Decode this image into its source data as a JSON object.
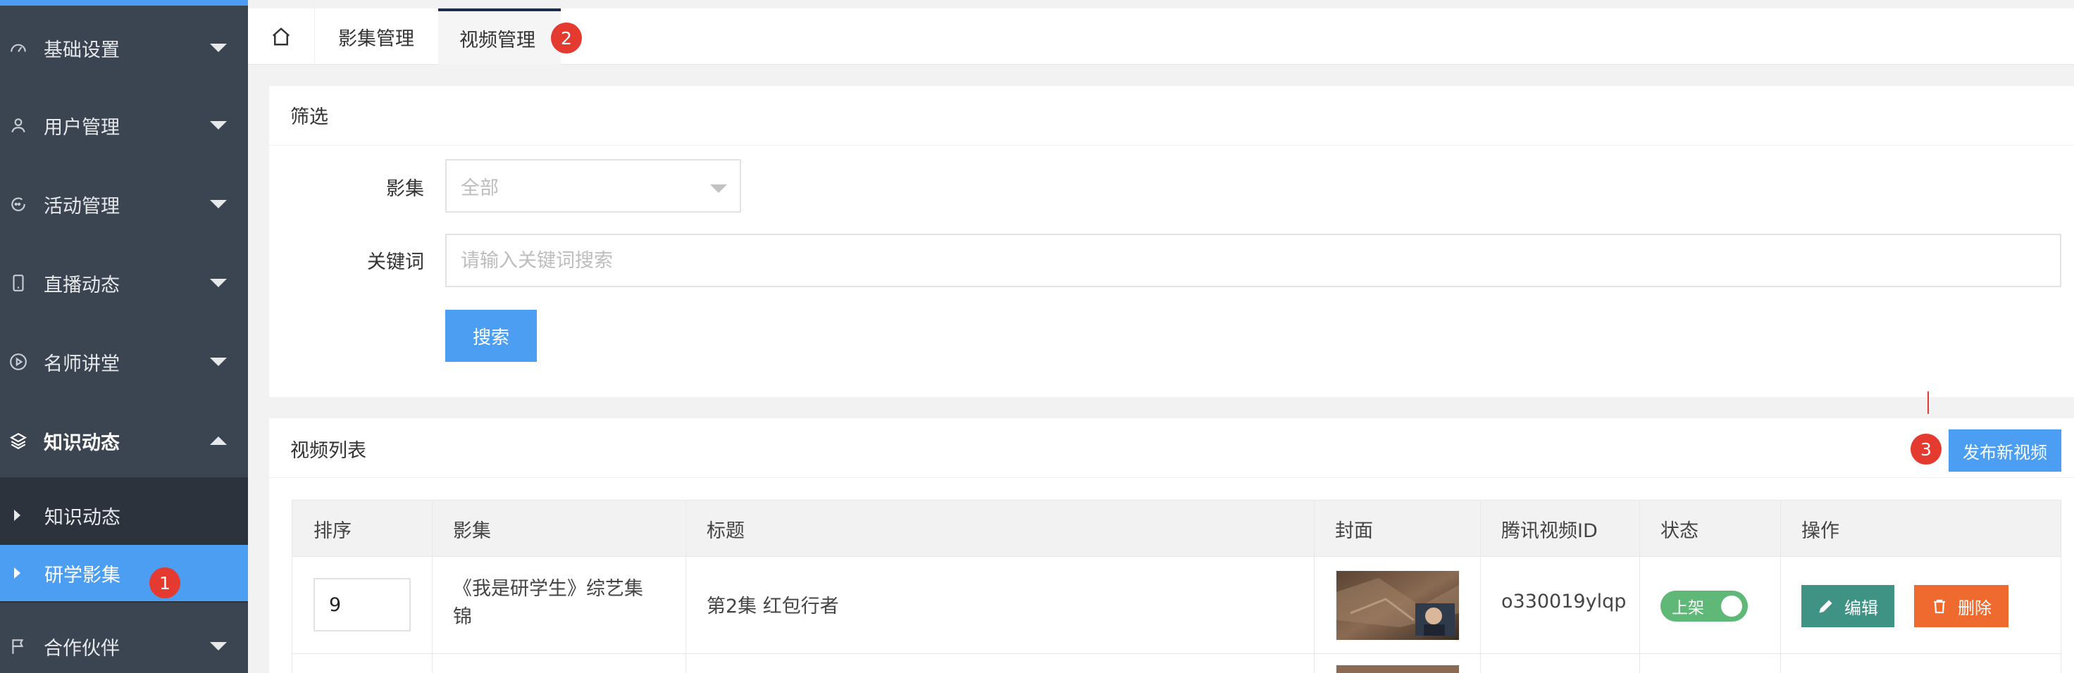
{
  "sidebar": {
    "accent_color": "#4b9ef1",
    "items": [
      {
        "label": "基础设置",
        "icon": "gauge-icon"
      },
      {
        "label": "用户管理",
        "icon": "user-icon"
      },
      {
        "label": "活动管理",
        "icon": "activity-icon"
      },
      {
        "label": "直播动态",
        "icon": "phone-icon"
      },
      {
        "label": "名师讲堂",
        "icon": "play-circle-icon"
      },
      {
        "label": "知识动态",
        "icon": "layers-icon"
      },
      {
        "label": "合作伙伴",
        "icon": "flag-icon"
      }
    ],
    "submenu": [
      {
        "label": "知识动态"
      },
      {
        "label": "研学影集"
      }
    ],
    "badge_1": "1"
  },
  "tabs": {
    "items": [
      {
        "label": "影集管理"
      },
      {
        "label": "视频管理"
      }
    ],
    "badge_2": "2"
  },
  "filter": {
    "title": "筛选",
    "album_label": "影集",
    "album_value": "全部",
    "keyword_label": "关键词",
    "keyword_placeholder": "请输入关键词搜索",
    "search_button": "搜索"
  },
  "list": {
    "title": "视频列表",
    "publish_button": "发布新视频",
    "badge_3": "3",
    "columns": [
      "排序",
      "影集",
      "标题",
      "封面",
      "腾讯视频ID",
      "状态",
      "操作"
    ],
    "rows": [
      {
        "order": "9",
        "album_line1": "《我是研学生》综艺集",
        "album_line2": "锦",
        "title": "第2集 红包行者",
        "tencent_id": "o330019ylqp",
        "status": "上架",
        "edit": "编辑",
        "delete": "删除"
      }
    ]
  }
}
